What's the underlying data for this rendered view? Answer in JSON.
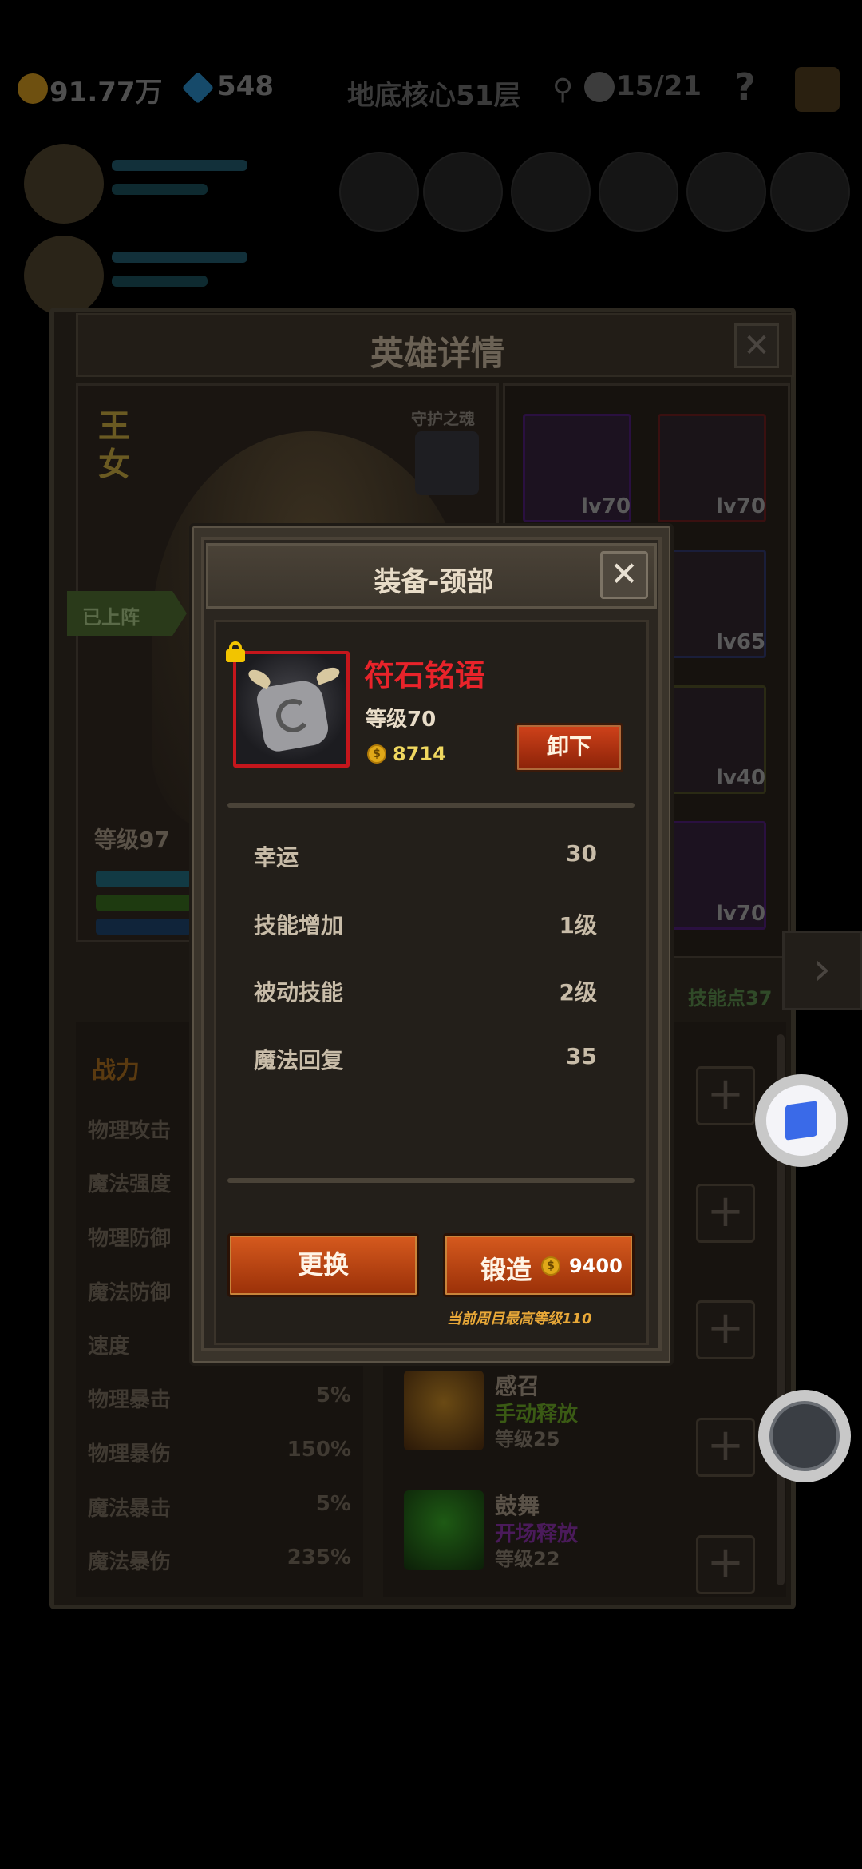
{
  "topbar": {
    "gold": "91.77万",
    "gems": "548",
    "floor": "地底核心51层",
    "kills": "15/21",
    "help": "?"
  },
  "hero_panel": {
    "title": "英雄详情",
    "close": "✕",
    "hero_name": "王女",
    "guardian_label": "守护之魂",
    "status_tag": "已上阵",
    "level_label": "等级97",
    "skill_points": "技能点37",
    "equip_slots": [
      {
        "level": "lv70"
      },
      {
        "level": "lv70"
      },
      {
        "level": "lv65"
      },
      {
        "level": "lv40"
      },
      {
        "level": "lv70"
      }
    ],
    "stats_header": "战力",
    "stats": [
      {
        "label": "物理攻击",
        "value": ""
      },
      {
        "label": "魔法强度",
        "value": ""
      },
      {
        "label": "物理防御",
        "value": ""
      },
      {
        "label": "魔法防御",
        "value": ""
      },
      {
        "label": "速度",
        "value": ""
      },
      {
        "label": "物理暴击",
        "value": "5%"
      },
      {
        "label": "物理暴伤",
        "value": "150%"
      },
      {
        "label": "魔法暴击",
        "value": "5%"
      },
      {
        "label": "魔法暴伤",
        "value": "235%"
      }
    ],
    "skills": [
      {
        "name": "感召",
        "mode": "手动释放",
        "level": "等级25",
        "mode_color": "#3a5a14"
      },
      {
        "name": "鼓舞",
        "mode": "开场释放",
        "level": "等级22",
        "mode_color": "#4a1a5a"
      }
    ]
  },
  "modal": {
    "title": "装备-颈部",
    "close": "✕",
    "item_name": "符石铭语",
    "item_level": "等级70",
    "item_price": "8714",
    "coin_symbol": "$",
    "unequip": "卸下",
    "attributes": [
      {
        "label": "幸运",
        "value": "30"
      },
      {
        "label": "技能增加",
        "value": "1级"
      },
      {
        "label": "被动技能",
        "value": "2级"
      },
      {
        "label": "魔法回复",
        "value": "35"
      }
    ],
    "replace": "更换",
    "forge": "锻造",
    "forge_cost": "9400",
    "max_level_note": "当前周目最高等级110"
  },
  "colors": {
    "item_name": "#e8232a",
    "rarity_border": "#c4161c",
    "button_orange": "#d65a1e",
    "gold_text": "#f0d860"
  },
  "icons": {
    "lock": "lock-icon",
    "coin": "coin-icon",
    "close": "close-icon",
    "next": "chevron-right-icon",
    "plus": "plus-icon"
  }
}
